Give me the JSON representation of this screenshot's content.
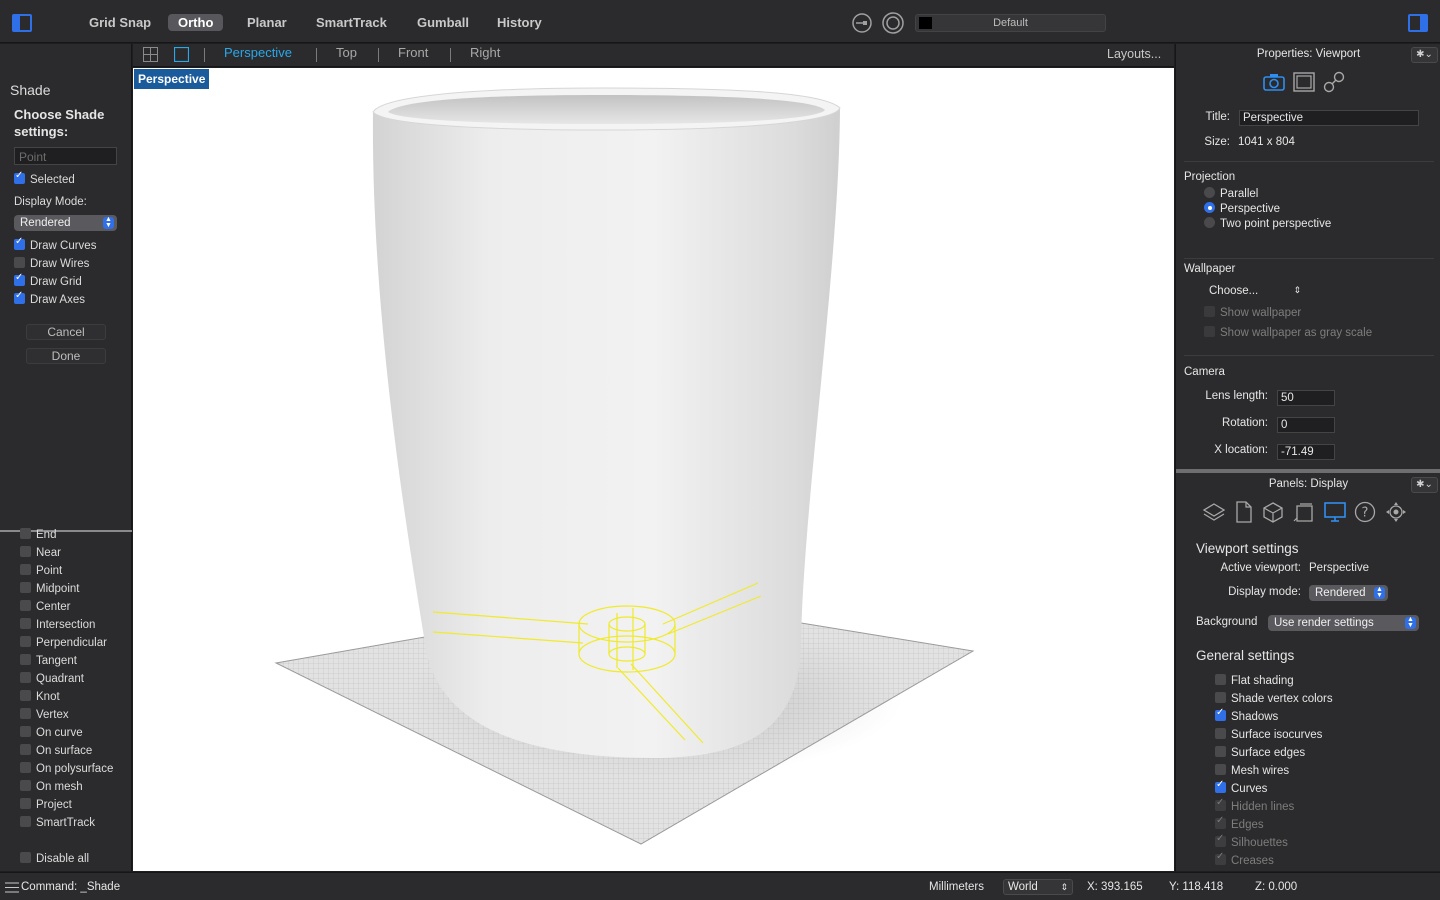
{
  "toolbar": {
    "modes": [
      {
        "label": "Grid Snap",
        "active": false
      },
      {
        "label": "Ortho",
        "active": true
      },
      {
        "label": "Planar",
        "active": false
      },
      {
        "label": "SmartTrack",
        "active": false
      },
      {
        "label": "Gumball",
        "active": false
      },
      {
        "label": "History",
        "active": false
      }
    ],
    "layer_name": "Default",
    "layer_color": "#000000",
    "accent": "#2f6fe8"
  },
  "command_panel": {
    "title": "Shade",
    "prompt": "Choose Shade settings:",
    "input_placeholder": "Point",
    "selected_label": "Selected",
    "selected_checked": true,
    "display_mode_label": "Display Mode:",
    "display_mode_value": "Rendered",
    "options": [
      {
        "label": "Draw Curves",
        "checked": true
      },
      {
        "label": "Draw Wires",
        "checked": false
      },
      {
        "label": "Draw Grid",
        "checked": true
      },
      {
        "label": "Draw Axes",
        "checked": true
      }
    ],
    "cancel_label": "Cancel",
    "done_label": "Done"
  },
  "osnaps": {
    "items": [
      "End",
      "Near",
      "Point",
      "Midpoint",
      "Center",
      "Intersection",
      "Perpendicular",
      "Tangent",
      "Quadrant",
      "Knot",
      "Vertex",
      "On curve",
      "On surface",
      "On polysurface",
      "On mesh",
      "Project",
      "SmartTrack"
    ],
    "disable_all_label": "Disable all"
  },
  "viewport_tabs": {
    "tabs": [
      "Perspective",
      "Top",
      "Front",
      "Right"
    ],
    "active_index": 0,
    "layouts_label": "Layouts..."
  },
  "viewport": {
    "label": "Perspective"
  },
  "properties": {
    "header": "Properties: Viewport",
    "title_label": "Title:",
    "title_value": "Perspective",
    "size_label": "Size:",
    "size_value": "1041 x 804",
    "projection_label": "Projection",
    "projection_options": [
      "Parallel",
      "Perspective",
      "Two point perspective"
    ],
    "projection_selected": 1,
    "wallpaper_label": "Wallpaper",
    "wallpaper_choose": "Choose...",
    "show_wallpaper": "Show wallpaper",
    "show_wallpaper_gray": "Show wallpaper as gray scale",
    "camera_label": "Camera",
    "lens_label": "Lens length:",
    "lens_value": "50",
    "rotation_label": "Rotation:",
    "rotation_value": "0",
    "xloc_label": "X location:",
    "xloc_value": "-71.49"
  },
  "display_panel": {
    "header": "Panels: Display",
    "viewport_settings": "Viewport settings",
    "active_viewport_label": "Active viewport:",
    "active_viewport_value": "Perspective",
    "display_mode_label": "Display mode:",
    "display_mode_value": "Rendered",
    "background_label": "Background",
    "background_value": "Use render settings",
    "general_settings": "General settings",
    "settings": [
      {
        "label": "Flat shading",
        "state": "off"
      },
      {
        "label": "Shade vertex colors",
        "state": "off"
      },
      {
        "label": "Shadows",
        "state": "on"
      },
      {
        "label": "Surface isocurves",
        "state": "off"
      },
      {
        "label": "Surface edges",
        "state": "off"
      },
      {
        "label": "Mesh wires",
        "state": "off"
      },
      {
        "label": "Curves",
        "state": "on"
      },
      {
        "label": "Hidden lines",
        "state": "dim"
      },
      {
        "label": "Edges",
        "state": "dim"
      },
      {
        "label": "Silhouettes",
        "state": "dim"
      },
      {
        "label": "Creases",
        "state": "dim"
      }
    ]
  },
  "statusbar": {
    "command": "Command: _Shade",
    "units": "Millimeters",
    "cplane": "World",
    "x": "X: 393.165",
    "y": "Y: 118.418",
    "z": "Z: 0.000"
  }
}
